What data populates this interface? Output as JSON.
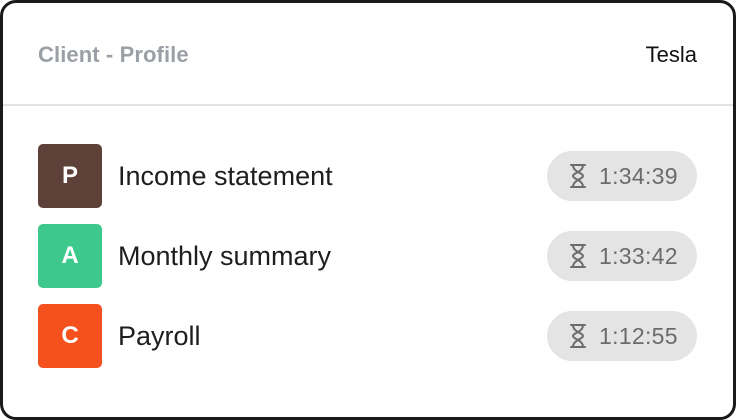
{
  "header": {
    "title": "Client - Profile",
    "client_name": "Tesla"
  },
  "items": [
    {
      "avatar_letter": "P",
      "avatar_color": "#5d4037",
      "label": "Income statement",
      "timer_icon": "hourglass-icon",
      "time": "1:34:39"
    },
    {
      "avatar_letter": "A",
      "avatar_color": "#3dc98b",
      "label": "Monthly summary",
      "timer_icon": "hourglass-icon",
      "time": "1:33:42"
    },
    {
      "avatar_letter": "C",
      "avatar_color": "#f4511e",
      "label": "Payroll",
      "timer_icon": "hourglass-icon",
      "time": "1:12:55"
    }
  ]
}
